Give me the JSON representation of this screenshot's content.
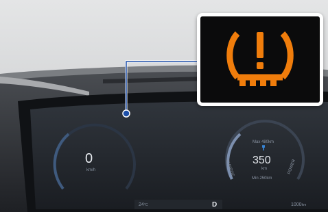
{
  "cluster": {
    "speed": {
      "value": "0",
      "unit": "km/h"
    },
    "range": {
      "max_label": "Max 480km",
      "value": "350",
      "unit": "km",
      "min_label": "Min 250km",
      "left_label": "CHARGE",
      "right_label": "POWER"
    },
    "temperature": "24",
    "temperature_unit": "°C",
    "gear": "D",
    "odometer_value": "1000",
    "odometer_unit": "km"
  },
  "warning": {
    "icon": "tire-pressure-warning-icon",
    "color": "#f07d0c"
  },
  "colors": {
    "accent_blue": "#2c6fd6",
    "callout_line": "#1d4fa8"
  }
}
